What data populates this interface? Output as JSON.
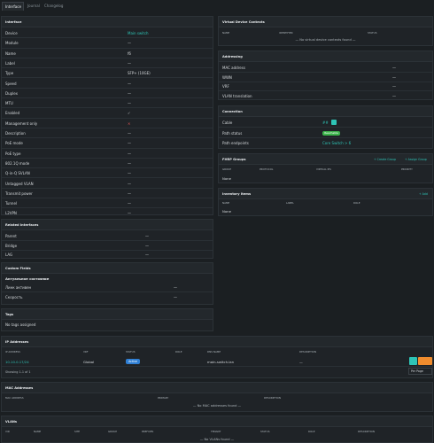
{
  "tabs": [
    "Interface",
    "Journal",
    "Changelog"
  ],
  "interface": {
    "title": "Interface",
    "rows": [
      {
        "k": "Device",
        "v": "Main switch",
        "teal": true
      },
      {
        "k": "Module",
        "v": "—"
      },
      {
        "k": "Name",
        "v": "f6"
      },
      {
        "k": "Label",
        "v": "—"
      },
      {
        "k": "Type",
        "v": "SFP+ (10GE)"
      },
      {
        "k": "Speed",
        "v": "—"
      },
      {
        "k": "Duplex",
        "v": "—"
      },
      {
        "k": "MTU",
        "v": "—"
      },
      {
        "k": "Enabled",
        "v": "✓"
      },
      {
        "k": "Management only",
        "v": "✕",
        "red": true
      },
      {
        "k": "Description",
        "v": "—"
      },
      {
        "k": "PoE mode",
        "v": "—"
      },
      {
        "k": "PoE type",
        "v": "—"
      },
      {
        "k": "802.1Q mode",
        "v": "—"
      },
      {
        "k": "Q-in-Q SVLAN",
        "v": "—"
      },
      {
        "k": "Untagged VLAN",
        "v": "—"
      },
      {
        "k": "Transmit power",
        "v": "—"
      },
      {
        "k": "Tunnel",
        "v": "—"
      },
      {
        "k": "L2VPN",
        "v": "—"
      }
    ]
  },
  "related": {
    "title": "Related Interfaces",
    "rows": [
      {
        "k": "Parent",
        "v": "—"
      },
      {
        "k": "Bridge",
        "v": "—"
      },
      {
        "k": "LAG",
        "v": "—"
      }
    ]
  },
  "custom": {
    "title": "Custom Fields",
    "group": "Актуальное состояние",
    "rows": [
      {
        "k": "Линк активен",
        "v": "—"
      },
      {
        "k": "Скорость",
        "v": "—"
      }
    ]
  },
  "tags": {
    "title": "Tags",
    "empty": "No tags assigned"
  },
  "vdc": {
    "title": "Virtual Device Contexts",
    "cols": [
      "Name",
      "Identifier",
      "Status"
    ],
    "empty": "— No virtual device contexts found —"
  },
  "addressing": {
    "title": "Addressing",
    "rows": [
      {
        "k": "MAC address",
        "v": "—"
      },
      {
        "k": "WWN",
        "v": "—"
      },
      {
        "k": "VRF",
        "v": "—"
      },
      {
        "k": "VLAN translation",
        "v": "—"
      }
    ]
  },
  "connection": {
    "title": "Connection",
    "cable_label": "Cable",
    "cable_value": "##",
    "path_status_label": "Path status",
    "path_status": "Reachable",
    "path_endpoints_label": "Path endpoints",
    "path_endpoints": "Core Switch > 6"
  },
  "fhrp": {
    "title": "FHRP Groups",
    "create": "+ Create Group",
    "assign": "+ Assign Group",
    "cols": [
      "Group",
      "Protocol",
      "Virtual IPs",
      "Priority"
    ],
    "empty": "None"
  },
  "inventory": {
    "title": "Inventory Items",
    "add": "+ Add",
    "cols": [
      "Name",
      "Label",
      "Role"
    ],
    "empty": "None"
  },
  "ip": {
    "title": "IP Addresses",
    "cols": [
      "IP Address",
      "VRF",
      "Status",
      "Role",
      "DNS Name",
      "Description"
    ],
    "row": {
      "address": "10.10.0.17/24",
      "vrf": "Global",
      "status": "Active",
      "role": "",
      "dns": "main-switch.lan",
      "desc": "—"
    },
    "showing": "Showing 1-1 of 1",
    "perpage": "Per Page"
  },
  "mac": {
    "title": "MAC Addresses",
    "cols": [
      "MAC Address",
      "Primary",
      "Description"
    ],
    "empty": "— No MAC addresses found —"
  },
  "vlans": {
    "title": "VLANs",
    "cols": [
      "VID",
      "Name",
      "Site",
      "Group",
      "Prefixes",
      "Tenant",
      "Status",
      "Role",
      "Description"
    ],
    "empty": "— No VLANs found —"
  },
  "colors": {
    "accent": "#2ec4b6",
    "active": "#2f7fd4",
    "reachable": "#3cb44b",
    "edit": "#2ec4b6",
    "delete": "#f08c2e"
  }
}
